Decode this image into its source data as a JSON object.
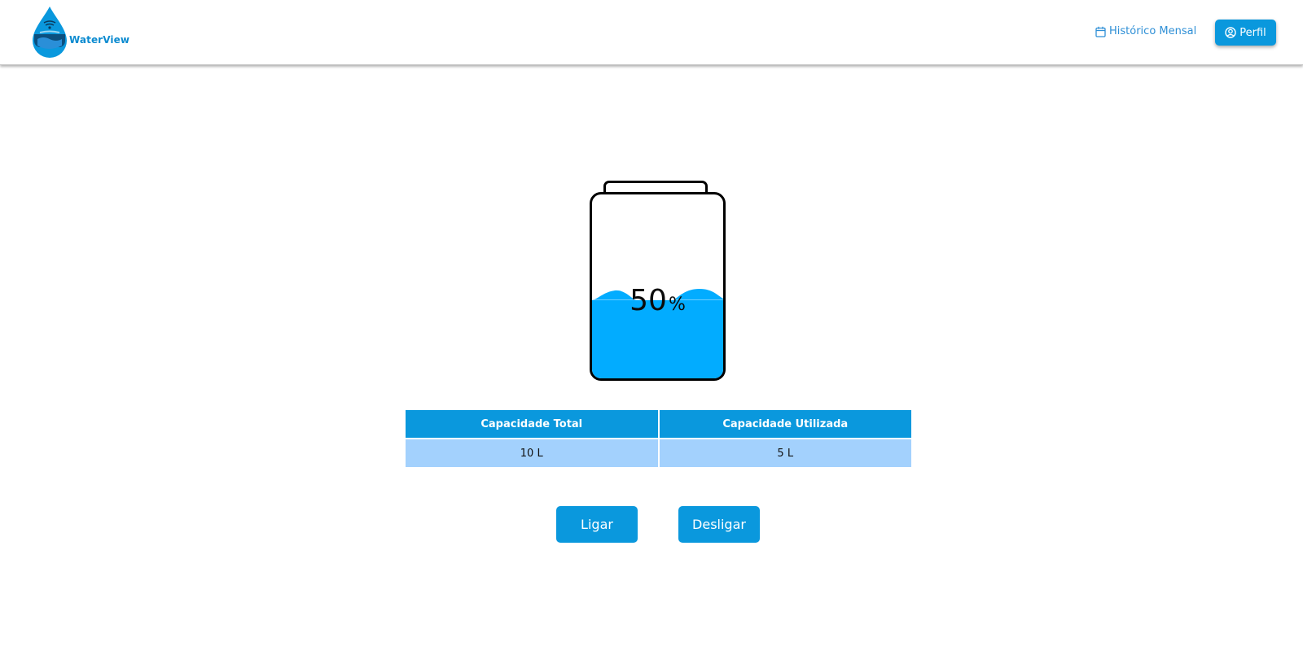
{
  "app": {
    "brand_name": "WaterView",
    "brand_color": "#0c8bd0",
    "accent_color": "#0a98dd",
    "water_color": "#02acff"
  },
  "nav": {
    "history_link": {
      "label": "Histórico Mensal",
      "icon": "calendar-icon"
    },
    "profile_button": {
      "label": "Perfil",
      "icon": "user-circle-icon"
    }
  },
  "tank": {
    "level_percent": 50,
    "level_value": "50",
    "level_unit": "%"
  },
  "capacity_table": {
    "headers": [
      "Capacidade Total",
      "Capacidade Utilizada"
    ],
    "rows": [
      [
        "10 L",
        "5 L"
      ]
    ]
  },
  "controls": {
    "on_label": "Ligar",
    "off_label": "Desligar"
  }
}
